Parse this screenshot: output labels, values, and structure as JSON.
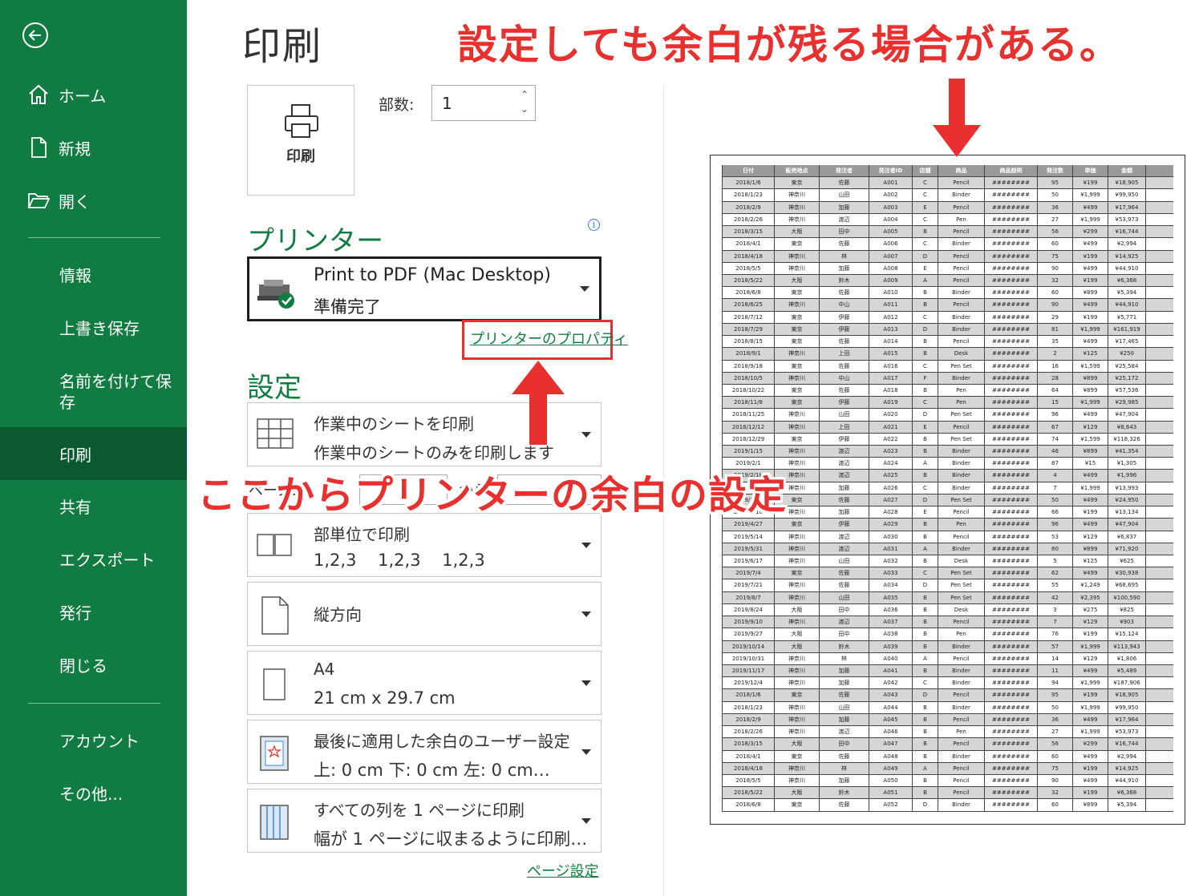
{
  "sidebar": {
    "items": [
      {
        "label": "ホーム",
        "icon": "home-icon"
      },
      {
        "label": "新規",
        "icon": "new-file-icon"
      },
      {
        "label": "開く",
        "icon": "folder-open-icon"
      },
      {
        "label": "情報"
      },
      {
        "label": "上書き保存"
      },
      {
        "label": "名前を付けて保存"
      },
      {
        "label": "印刷",
        "active": true
      },
      {
        "label": "共有"
      },
      {
        "label": "エクスポート"
      },
      {
        "label": "発行"
      },
      {
        "label": "閉じる"
      },
      {
        "label": "アカウント"
      },
      {
        "label": "その他..."
      }
    ],
    "saveas_line1": "名前を付けて保",
    "saveas_line2": "存"
  },
  "main": {
    "title": "印刷",
    "print_button_label": "印刷",
    "copies_label": "部数:",
    "copies_value": "1",
    "printer_section": "プリンター",
    "printer": {
      "name": "Print to PDF (Mac Desktop)",
      "status": "準備完了"
    },
    "printer_properties": "プリンターのプロパティ",
    "settings_section": "設定",
    "settings": {
      "scope": {
        "title": "作業中のシートを印刷",
        "sub": "作業中のシートのみを印刷します"
      },
      "pages_label": "ページ:",
      "pages_to": "から",
      "collate": {
        "title": "部単位で印刷",
        "sub": "1,2,3    1,2,3    1,2,3"
      },
      "orientation": "縦方向",
      "paper": {
        "title": "A4",
        "sub": "21 cm x 29.7 cm"
      },
      "margins": {
        "title": "最後に適用した余白のユーザー設定",
        "sub": "上: 0 cm 下: 0 cm 左: 0 cm…"
      },
      "scaling": {
        "title": "すべての列を 1 ページに印刷",
        "sub": "幅が 1 ページに収まるように印刷…"
      }
    },
    "page_setup": "ページ設定"
  },
  "annotations": {
    "top": "設定しても余白が残る場合がある。",
    "middle": "ここからプリンターの余白の設定"
  },
  "colors": {
    "brand_green": "#107c41",
    "active_green": "#0b5a2f",
    "annotation_red": "#e8312f"
  },
  "preview": {
    "headers": [
      "日付",
      "販売地点",
      "発注者",
      "発注者ID",
      "店舗",
      "商品",
      "商品説明",
      "発注数",
      "単価",
      "金額"
    ],
    "rows": [
      [
        "2018/1/6",
        "東京",
        "佐藤",
        "A001",
        "C",
        "Pencil",
        "########",
        "95",
        "¥199",
        "¥18,905"
      ],
      [
        "2018/1/23",
        "神奈川",
        "山田",
        "A002",
        "C",
        "Binder",
        "########",
        "50",
        "¥1,999",
        "¥99,950"
      ],
      [
        "2018/2/9",
        "神奈川",
        "加藤",
        "A003",
        "E",
        "Pencil",
        "########",
        "36",
        "¥499",
        "¥17,964"
      ],
      [
        "2018/2/26",
        "神奈川",
        "渡辺",
        "A004",
        "C",
        "Pen",
        "########",
        "27",
        "¥1,999",
        "¥53,973"
      ],
      [
        "2018/3/15",
        "大阪",
        "田中",
        "A005",
        "B",
        "Pencil",
        "########",
        "56",
        "¥299",
        "¥16,744"
      ],
      [
        "2018/4/1",
        "東京",
        "佐藤",
        "A006",
        "C",
        "Binder",
        "########",
        "60",
        "¥499",
        "¥2,994"
      ],
      [
        "2018/4/18",
        "神奈川",
        "林",
        "A007",
        "D",
        "Pencil",
        "########",
        "75",
        "¥199",
        "¥14,925"
      ],
      [
        "2018/5/5",
        "神奈川",
        "加藤",
        "A008",
        "E",
        "Pencil",
        "########",
        "90",
        "¥499",
        "¥44,910"
      ],
      [
        "2018/5/22",
        "大阪",
        "鈴木",
        "A009",
        "A",
        "Pencil",
        "########",
        "32",
        "¥199",
        "¥6,368"
      ],
      [
        "2018/6/8",
        "東京",
        "佐藤",
        "A010",
        "B",
        "Binder",
        "########",
        "60",
        "¥899",
        "¥5,394"
      ],
      [
        "2018/6/25",
        "神奈川",
        "中山",
        "A011",
        "B",
        "Pencil",
        "########",
        "90",
        "¥499",
        "¥44,910"
      ],
      [
        "2018/7/12",
        "東京",
        "伊藤",
        "A012",
        "C",
        "Binder",
        "########",
        "29",
        "¥199",
        "¥5,771"
      ],
      [
        "2018/7/29",
        "東京",
        "伊藤",
        "A013",
        "D",
        "Binder",
        "########",
        "81",
        "¥1,999",
        "¥161,919"
      ],
      [
        "2018/8/15",
        "東京",
        "佐藤",
        "A014",
        "B",
        "Pencil",
        "########",
        "35",
        "¥499",
        "¥17,465"
      ],
      [
        "2018/9/1",
        "神奈川",
        "上田",
        "A015",
        "B",
        "Desk",
        "########",
        "2",
        "¥125",
        "¥250"
      ],
      [
        "2018/9/18",
        "東京",
        "佐藤",
        "A016",
        "C",
        "Pen Set",
        "########",
        "16",
        "¥1,599",
        "¥25,584"
      ],
      [
        "2018/10/5",
        "神奈川",
        "中山",
        "A017",
        "F",
        "Binder",
        "########",
        "28",
        "¥899",
        "¥25,172"
      ],
      [
        "2018/10/22",
        "東京",
        "佐藤",
        "A018",
        "B",
        "Pen",
        "########",
        "64",
        "¥899",
        "¥57,536"
      ],
      [
        "2018/11/8",
        "東京",
        "伊藤",
        "A019",
        "C",
        "Pen",
        "########",
        "15",
        "¥1,999",
        "¥29,985"
      ],
      [
        "2018/11/25",
        "神奈川",
        "山田",
        "A020",
        "D",
        "Pen Set",
        "########",
        "96",
        "¥499",
        "¥47,904"
      ],
      [
        "2018/12/12",
        "神奈川",
        "上田",
        "A021",
        "E",
        "Pencil",
        "########",
        "67",
        "¥129",
        "¥8,643"
      ],
      [
        "2018/12/29",
        "東京",
        "伊藤",
        "A022",
        "B",
        "Pen Set",
        "########",
        "74",
        "¥1,599",
        "¥118,326"
      ],
      [
        "2019/1/15",
        "神奈川",
        "渡辺",
        "A023",
        "B",
        "Binder",
        "########",
        "46",
        "¥899",
        "¥41,354"
      ],
      [
        "2019/2/1",
        "神奈川",
        "渡辺",
        "A024",
        "A",
        "Binder",
        "########",
        "87",
        "¥15",
        "¥1,305"
      ],
      [
        "2019/2/18",
        "神奈川",
        "渡辺",
        "A025",
        "B",
        "Binder",
        "########",
        "4",
        "¥499",
        "¥1,996"
      ],
      [
        "2019/3/7",
        "神奈川",
        "加藤",
        "A026",
        "C",
        "Binder",
        "########",
        "7",
        "¥1,999",
        "¥13,993"
      ],
      [
        "2019/3/24",
        "東京",
        "佐藤",
        "A027",
        "D",
        "Pen Set",
        "########",
        "50",
        "¥499",
        "¥24,950"
      ],
      [
        "2019/4/10",
        "神奈川",
        "加藤",
        "A028",
        "E",
        "Pencil",
        "########",
        "66",
        "¥199",
        "¥13,134"
      ],
      [
        "2019/4/27",
        "東京",
        "伊藤",
        "A029",
        "B",
        "Pen",
        "########",
        "96",
        "¥499",
        "¥47,904"
      ],
      [
        "2019/5/14",
        "神奈川",
        "渡辺",
        "A030",
        "B",
        "Pencil",
        "########",
        "53",
        "¥129",
        "¥6,837"
      ],
      [
        "2019/5/31",
        "神奈川",
        "渡辺",
        "A031",
        "A",
        "Binder",
        "########",
        "80",
        "¥899",
        "¥71,920"
      ],
      [
        "2019/6/17",
        "神奈川",
        "山田",
        "A032",
        "B",
        "Desk",
        "########",
        "5",
        "¥125",
        "¥625"
      ],
      [
        "2019/7/4",
        "東京",
        "佐藤",
        "A033",
        "C",
        "Pen Set",
        "########",
        "62",
        "¥499",
        "¥30,938"
      ],
      [
        "2019/7/21",
        "神奈川",
        "佐藤",
        "A034",
        "D",
        "Pen Set",
        "########",
        "55",
        "¥1,249",
        "¥68,695"
      ],
      [
        "2019/8/7",
        "神奈川",
        "山田",
        "A035",
        "B",
        "Pen Set",
        "########",
        "42",
        "¥2,395",
        "¥100,590"
      ],
      [
        "2019/8/24",
        "大阪",
        "田中",
        "A036",
        "B",
        "Desk",
        "########",
        "3",
        "¥275",
        "¥825"
      ],
      [
        "2019/9/10",
        "神奈川",
        "渡辺",
        "A037",
        "B",
        "Pencil",
        "########",
        "7",
        "¥129",
        "¥903"
      ],
      [
        "2019/9/27",
        "大阪",
        "田中",
        "A038",
        "B",
        "Pen",
        "########",
        "76",
        "¥199",
        "¥15,124"
      ],
      [
        "2019/10/14",
        "大阪",
        "鈴木",
        "A039",
        "B",
        "Binder",
        "########",
        "57",
        "¥1,999",
        "¥113,943"
      ],
      [
        "2019/10/31",
        "神奈川",
        "林",
        "A040",
        "A",
        "Pencil",
        "########",
        "14",
        "¥129",
        "¥1,806"
      ],
      [
        "2019/11/17",
        "神奈川",
        "加藤",
        "A041",
        "B",
        "Binder",
        "########",
        "11",
        "¥499",
        "¥5,489"
      ],
      [
        "2019/12/4",
        "神奈川",
        "加藤",
        "A042",
        "C",
        "Binder",
        "########",
        "94",
        "¥1,999",
        "¥187,906"
      ],
      [
        "2018/1/6",
        "東京",
        "佐藤",
        "A043",
        "D",
        "Pencil",
        "########",
        "95",
        "¥199",
        "¥18,905"
      ],
      [
        "2018/1/23",
        "神奈川",
        "山田",
        "A044",
        "B",
        "Binder",
        "########",
        "50",
        "¥1,999",
        "¥99,950"
      ],
      [
        "2018/2/9",
        "神奈川",
        "加藤",
        "A045",
        "B",
        "Pencil",
        "########",
        "36",
        "¥499",
        "¥17,964"
      ],
      [
        "2018/2/26",
        "神奈川",
        "渡辺",
        "A046",
        "B",
        "Pen",
        "########",
        "27",
        "¥1,999",
        "¥53,973"
      ],
      [
        "2018/3/15",
        "大阪",
        "田中",
        "A047",
        "B",
        "Pencil",
        "########",
        "56",
        "¥299",
        "¥16,744"
      ],
      [
        "2018/4/1",
        "東京",
        "佐藤",
        "A048",
        "B",
        "Binder",
        "########",
        "60",
        "¥499",
        "¥2,994"
      ],
      [
        "2018/4/18",
        "神奈川",
        "林",
        "A049",
        "A",
        "Pencil",
        "########",
        "75",
        "¥199",
        "¥14,925"
      ],
      [
        "2018/5/5",
        "神奈川",
        "加藤",
        "A050",
        "B",
        "Pencil",
        "########",
        "90",
        "¥499",
        "¥44,910"
      ],
      [
        "2018/5/22",
        "大阪",
        "鈴木",
        "A051",
        "B",
        "Pencil",
        "########",
        "32",
        "¥199",
        "¥6,368"
      ],
      [
        "2018/6/8",
        "東京",
        "佐藤",
        "A052",
        "D",
        "Binder",
        "########",
        "60",
        "¥899",
        "¥5,394"
      ]
    ]
  }
}
